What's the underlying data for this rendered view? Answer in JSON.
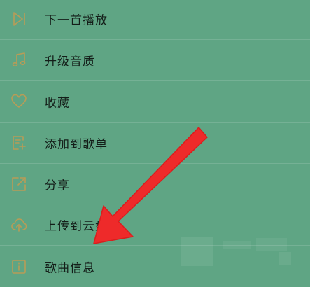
{
  "menu": {
    "items": [
      {
        "label": "下一首播放",
        "icon": "play-next-icon"
      },
      {
        "label": "升级音质",
        "icon": "music-note-icon"
      },
      {
        "label": "收藏",
        "icon": "heart-icon"
      },
      {
        "label": "添加到歌单",
        "icon": "add-playlist-icon"
      },
      {
        "label": "分享",
        "icon": "share-icon"
      },
      {
        "label": "上传到云盘",
        "icon": "cloud-upload-icon"
      },
      {
        "label": "歌曲信息",
        "icon": "info-icon"
      }
    ]
  },
  "colors": {
    "background": "#5fa584",
    "icon": "#b89c57",
    "text": "#141e19",
    "arrow": "#ee2a2a"
  }
}
